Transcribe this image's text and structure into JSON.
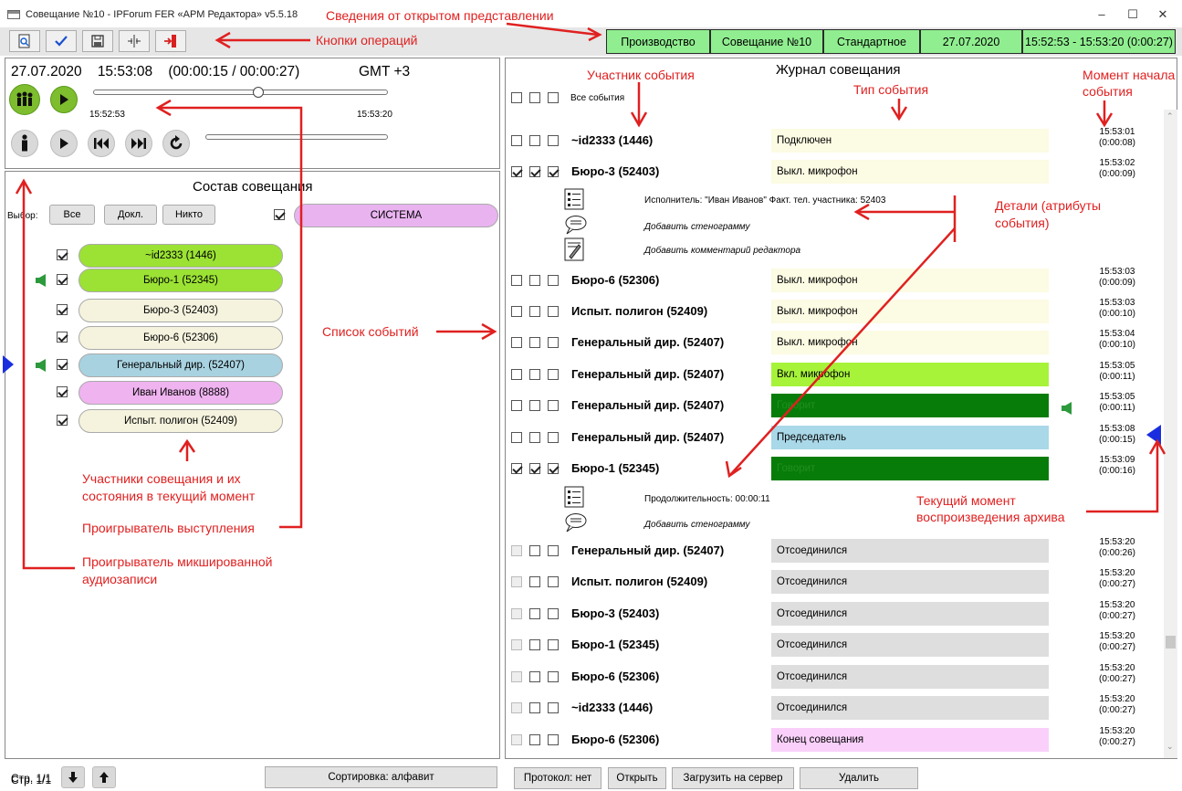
{
  "window": {
    "title": "Совещание №10 - IPForum FER «АРМ Редактора» v5.5.18",
    "minimize": "–",
    "maximize": "☐",
    "close": "✕"
  },
  "toolbar": {
    "buttons": [
      "preview-icon",
      "check-icon",
      "save-icon",
      "split-icon",
      "exit-icon"
    ],
    "info": [
      "Производство",
      "Совещание №10",
      "Стандартное",
      "27.07.2020",
      "15:52:53 - 15:53:20 (0:00:27)"
    ],
    "info_color": "#90ee90"
  },
  "annotations": {
    "view_info": "Сведения от открытом представлении",
    "operation_buttons": "Кнопки операций",
    "event_participant": "Участник события",
    "event_type": "Тип события",
    "event_start_1": "Момент начала",
    "event_start_2": "события",
    "details_1": "Детали (атрибуты",
    "details_2": "события)",
    "event_list": "Список событий",
    "current_moment_1": "Текущий момент",
    "current_moment_2": "воспроизведения архива",
    "participants_1": "Участники совещания и их",
    "participants_2": "состояния в текущий момент",
    "speech_player": "Проигрыватель  выступления",
    "mix_player_1": "Проигрыватель микшированной",
    "mix_player_2": "аудиозаписи",
    "color": "#e02020"
  },
  "player": {
    "date": "27.07.2020",
    "time": "15:53:08",
    "position": "(00:00:15 / 00:00:27)",
    "timezone": "GMT +3",
    "range_start": "15:52:53",
    "range_end": "15:53:20",
    "progress": 0.56
  },
  "composition": {
    "title": "Состав совещания",
    "select_label": "Выбор:",
    "btn_all": "Все",
    "btn_reports": "Докл.",
    "btn_none": "Никто",
    "system_label": "СИСТЕМА",
    "system_color": "#e9b3f0",
    "participants": [
      {
        "name": "~id2333 (1446)",
        "color": "#9be234",
        "speaking": false,
        "current": false
      },
      {
        "name": "Бюро-1 (52345)",
        "color": "#9be234",
        "speaking": true,
        "current": false
      },
      {
        "name": "Бюро-3 (52403)",
        "color": "#f5f3de",
        "speaking": false,
        "current": false
      },
      {
        "name": "Бюро-6 (52306)",
        "color": "#f5f3de",
        "speaking": false,
        "current": false
      },
      {
        "name": "Генеральный дир. (52407)",
        "color": "#a8d2e0",
        "speaking": true,
        "current": true
      },
      {
        "name": "Иван Иванов (8888)",
        "color": "#efb3f0",
        "speaking": false,
        "current": false
      },
      {
        "name": "Испыт. полигон (52409)",
        "color": "#f5f3de",
        "speaking": false,
        "current": false
      }
    ],
    "page": "Стр. 1/1",
    "sort_label": "Сортировка: алфавит"
  },
  "journal": {
    "title": "Журнал совещания",
    "all_events": "Все события",
    "events": [
      {
        "name": "~id2333 (1446)",
        "type": "Подключен",
        "color": "#fcfbe3",
        "time": "15:53:01",
        "offset": "(0:00:08)",
        "checks": [
          false,
          false,
          false
        ]
      },
      {
        "name": "Бюро-3 (52403)",
        "type": "Выкл. микрофон",
        "color": "#fcfbe3",
        "time": "15:53:02",
        "offset": "(0:00:09)",
        "checks": [
          true,
          true,
          true
        ]
      },
      {
        "name": "Бюро-6 (52306)",
        "type": "Выкл. микрофон",
        "color": "#fcfbe3",
        "time": "15:53:03",
        "offset": "(0:00:09)",
        "checks": [
          false,
          false,
          false
        ]
      },
      {
        "name": "Испыт. полигон (52409)",
        "type": "Выкл. микрофон",
        "color": "#fcfbe3",
        "time": "15:53:03",
        "offset": "(0:00:10)",
        "checks": [
          false,
          false,
          false
        ]
      },
      {
        "name": "Генеральный дир. (52407)",
        "type": "Выкл. микрофон",
        "color": "#fcfbe3",
        "time": "15:53:04",
        "offset": "(0:00:10)",
        "checks": [
          false,
          false,
          false
        ]
      },
      {
        "name": "Генеральный дир. (52407)",
        "type": "Вкл. микрофон",
        "color": "#a6f33a",
        "time": "15:53:05",
        "offset": "(0:00:11)",
        "checks": [
          false,
          false,
          false
        ]
      },
      {
        "name": "Генеральный дир. (52407)",
        "type": "Говорит",
        "color": "#087c08",
        "time": "15:53:05",
        "offset": "(0:00:11)",
        "checks": [
          false,
          false,
          false
        ]
      },
      {
        "name": "Генеральный дир. (52407)",
        "type": "Председатель",
        "color": "#a9d8e8",
        "time": "15:53:08",
        "offset": "(0:00:15)",
        "checks": [
          false,
          false,
          false
        ]
      },
      {
        "name": "Бюро-1 (52345)",
        "type": "Говорит",
        "color": "#087c08",
        "time": "15:53:09",
        "offset": "(0:00:16)",
        "checks": [
          true,
          true,
          true
        ]
      },
      {
        "name": "Генеральный дир. (52407)",
        "type": "Отсоединился",
        "color": "#dedede",
        "time": "15:53:20",
        "offset": "(0:00:26)",
        "checks": [
          false,
          false,
          false
        ]
      },
      {
        "name": "Испыт. полигон (52409)",
        "type": "Отсоединился",
        "color": "#dedede",
        "time": "15:53:20",
        "offset": "(0:00:27)",
        "checks": [
          false,
          false,
          false
        ]
      },
      {
        "name": "Бюро-3 (52403)",
        "type": "Отсоединился",
        "color": "#dedede",
        "time": "15:53:20",
        "offset": "(0:00:27)",
        "checks": [
          false,
          false,
          false
        ]
      },
      {
        "name": "Бюро-1 (52345)",
        "type": "Отсоединился",
        "color": "#dedede",
        "time": "15:53:20",
        "offset": "(0:00:27)",
        "checks": [
          false,
          false,
          false
        ]
      },
      {
        "name": "Бюро-6 (52306)",
        "type": "Отсоединился",
        "color": "#dedede",
        "time": "15:53:20",
        "offset": "(0:00:27)",
        "checks": [
          false,
          false,
          false
        ]
      },
      {
        "name": "~id2333 (1446)",
        "type": "Отсоединился",
        "color": "#dedede",
        "time": "15:53:20",
        "offset": "(0:00:27)",
        "checks": [
          false,
          false,
          false
        ]
      },
      {
        "name": "Бюро-6 (52306)",
        "type": "Конец совещания",
        "color": "#fad0fb",
        "time": "15:53:20",
        "offset": "(0:00:27)",
        "checks": [
          false,
          false,
          false
        ]
      }
    ],
    "details_buro3": {
      "executor": "Исполнитель: \"Иван Иванов\" Факт. тел. участника: 52403",
      "add_transcript": "Добавить стенограмму",
      "add_comment": "Добавить комментарий редактора"
    },
    "details_buro1": {
      "duration": "Продолжительность: 00:00:11",
      "add_transcript": "Добавить стенограмму"
    },
    "btn_protocol": "Протокол: нет",
    "btn_open": "Открыть",
    "btn_upload": "Загрузить на сервер",
    "btn_delete": "Удалить"
  }
}
